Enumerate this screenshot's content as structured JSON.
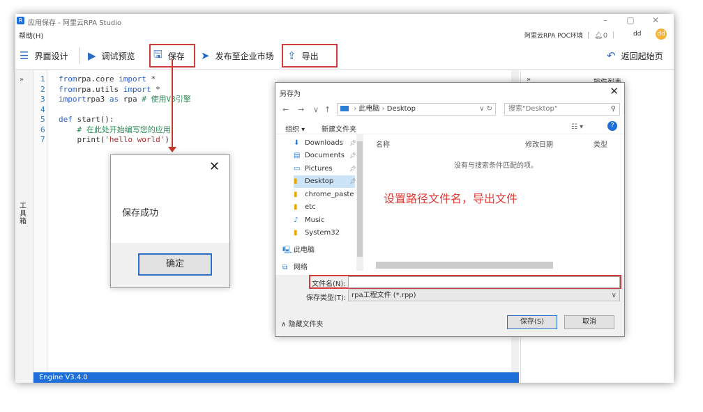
{
  "window": {
    "title": "应用保存 - 阿里云RPA Studio",
    "app_icon": "R"
  },
  "menu": {
    "help": "帮助(H)",
    "env": "阿里云RPA POC环境 ｜",
    "bell_count": "0",
    "divider": "｜",
    "user": "dd",
    "avatar": "dd"
  },
  "toolbar": {
    "ui_design": "界面设计",
    "debug_preview": "调试预览",
    "save": "保存",
    "publish": "发布至企业市场",
    "export": "导出",
    "back_home": "返回起始页"
  },
  "left_rail": {
    "toolbox": "工具箱"
  },
  "editor": {
    "lines": [
      {
        "n": "1",
        "parts": [
          [
            "kw",
            "from"
          ],
          [
            "",
            "rpa.core "
          ],
          [
            "kw",
            "import"
          ],
          [
            "",
            " *"
          ]
        ]
      },
      {
        "n": "2",
        "parts": [
          [
            "kw",
            "from"
          ],
          [
            "",
            "rpa.utils "
          ],
          [
            "kw",
            "import"
          ],
          [
            "",
            " *"
          ]
        ]
      },
      {
        "n": "3",
        "parts": [
          [
            "kw",
            "import"
          ],
          [
            "",
            "rpa3 "
          ],
          [
            "kw",
            "as"
          ],
          [
            "",
            " rpa "
          ],
          [
            "cm",
            "# 使用V3引擎"
          ]
        ]
      },
      {
        "n": "4",
        "parts": []
      },
      {
        "n": "5",
        "parts": [
          [
            "kw",
            "def"
          ],
          [
            "",
            " start():"
          ]
        ]
      },
      {
        "n": "6",
        "parts": [
          [
            "",
            "    "
          ],
          [
            "cm",
            "# 在此处开始编写您的应用"
          ]
        ]
      },
      {
        "n": "7",
        "parts": [
          [
            "",
            "    print("
          ],
          [
            "str",
            "'hello world'"
          ],
          [
            "",
            ")"
          ]
        ]
      }
    ],
    "status": "Engine V3.4.0"
  },
  "right_panel": {
    "title": "控件列表"
  },
  "message_box": {
    "text": "保存成功",
    "ok": "确定"
  },
  "save_dialog": {
    "title": "另存为",
    "breadcrumb": [
      "此电脑",
      "Desktop"
    ],
    "search_placeholder": "搜索\"Desktop\"",
    "organize": "组织 ▾",
    "new_folder": "新建文件夹",
    "nav_items": [
      {
        "label": "Downloads",
        "icon": "download-icon",
        "pinned": true
      },
      {
        "label": "Documents",
        "icon": "document-icon",
        "pinned": true
      },
      {
        "label": "Pictures",
        "icon": "picture-icon",
        "pinned": true
      },
      {
        "label": "Desktop",
        "icon": "folder-icon",
        "pinned": true,
        "selected": true
      },
      {
        "label": "chrome_paste",
        "icon": "folder-icon",
        "pinned": false
      },
      {
        "label": "etc",
        "icon": "folder-icon",
        "pinned": false
      },
      {
        "label": "Music",
        "icon": "music-icon",
        "pinned": false
      },
      {
        "label": "System32",
        "icon": "folder-icon",
        "pinned": false
      },
      {
        "label": "此电脑",
        "icon": "computer-icon",
        "pinned": false
      },
      {
        "label": "网络",
        "icon": "network-icon",
        "pinned": false
      }
    ],
    "columns": [
      "名称",
      "修改日期",
      "类型"
    ],
    "empty_text": "没有与搜索条件匹配的项。",
    "filename_label": "文件名(N):",
    "filename_value": "",
    "filetype_label": "保存类型(T):",
    "filetype_value": "rpa工程文件 (*.rpp)",
    "hide_folders": "∧ 隐藏文件夹",
    "save_button": "保存(S)",
    "cancel_button": "取消"
  },
  "annotation": "设置路径文件名，导出文件",
  "colors": {
    "accent": "#1e6fd9",
    "highlight": "#d33b3b",
    "annotation": "#e53935"
  }
}
